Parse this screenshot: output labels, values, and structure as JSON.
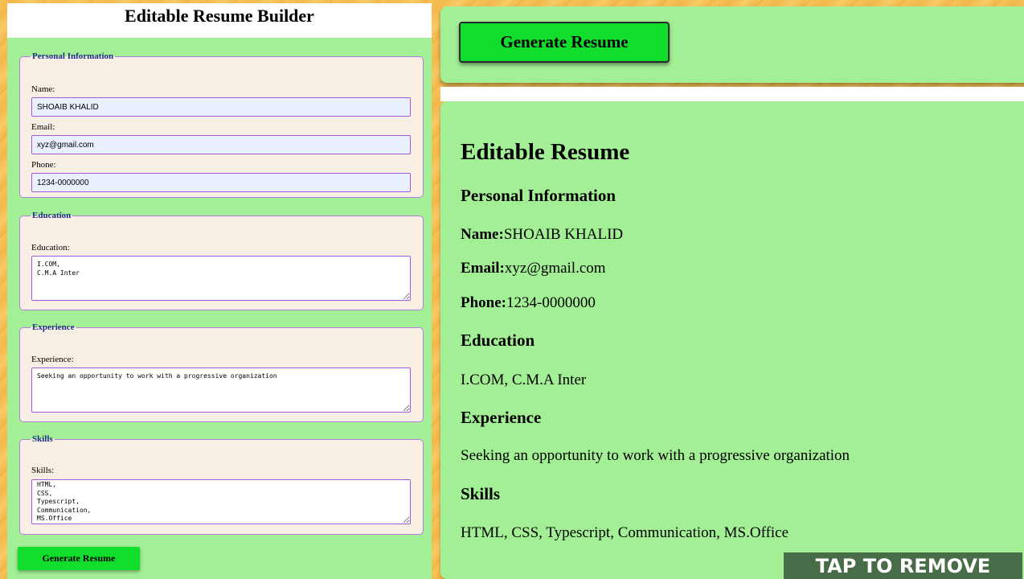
{
  "builder": {
    "title": "Editable Resume Builder",
    "personal": {
      "legend": "Personal Information",
      "name_label": "Name:",
      "name_value": "SHOAIB KHALID",
      "email_label": "Email:",
      "email_value": "xyz@gmail.com",
      "phone_label": "Phone:",
      "phone_value": "1234-0000000"
    },
    "education": {
      "legend": "Education",
      "label": "Education:",
      "value": "I.COM,\nC.M.A Inter"
    },
    "experience": {
      "legend": "Experience",
      "label": "Experience:",
      "value": "Seeking an opportunity to work with a progressive organization"
    },
    "skills": {
      "legend": "Skills",
      "label": "Skills:",
      "value": "HTML,\nCSS,\nTypescript,\nCommunication,\nMS.Office"
    },
    "generate_button": "Generate Resume"
  },
  "top_card": {
    "generate_button": "Generate Resume"
  },
  "preview": {
    "heading": "Editable Resume",
    "personal_heading": "Personal Information",
    "name_label": "Name:",
    "name_value": "SHOAIB KHALID",
    "email_label": "Email:",
    "email_value": "xyz@gmail.com",
    "phone_label": "Phone:",
    "phone_value": "1234-0000000",
    "education_heading": "Education",
    "education_text": "I.COM, C.M.A Inter",
    "experience_heading": "Experience",
    "experience_text": "Seeking an opportunity to work with a progressive organization",
    "skills_heading": "Skills",
    "skills_text": "HTML, CSS, Typescript, Communication, MS.Office"
  },
  "overlay": {
    "tap_to_remove": "TAP TO REMOVE"
  },
  "colors": {
    "panel_green": "#a3ef95",
    "button_green": "#10dd2c",
    "fieldset_bg": "#f7efe4",
    "fieldset_border": "#b67de0",
    "legend_text": "#1e2b8a",
    "autofill_bg": "#e8f0fe",
    "overlay_bg": "#486c47"
  }
}
